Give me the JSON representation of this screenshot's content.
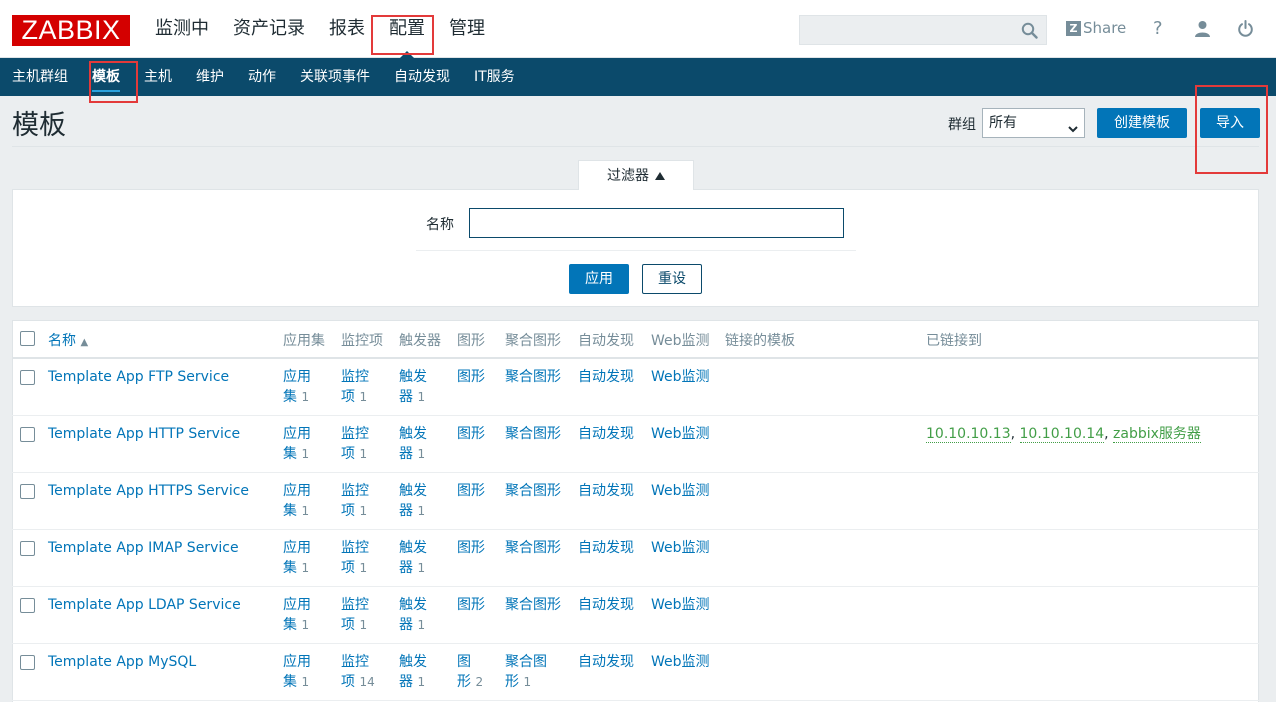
{
  "header": {
    "logo": "ZABBIX",
    "main_nav": [
      "监测中",
      "资产记录",
      "报表",
      "配置",
      "管理"
    ],
    "share": "Share",
    "help": "?",
    "search_value": ""
  },
  "sub_nav": [
    "主机群组",
    "模板",
    "主机",
    "维护",
    "动作",
    "关联项事件",
    "自动发现",
    "IT服务"
  ],
  "page": {
    "title": "模板",
    "group_label": "群组",
    "group_value": "所有",
    "create_button": "创建模板",
    "import_button": "导入"
  },
  "filter": {
    "tab_label": "过滤器",
    "name_label": "名称",
    "name_value": "",
    "apply_button": "应用",
    "reset_button": "重设"
  },
  "table": {
    "columns": {
      "name": "名称",
      "applications": "应用集",
      "items": "监控项",
      "triggers": "触发器",
      "graphs": "图形",
      "screens": "聚合图形",
      "discovery": "自动发现",
      "web": "Web监测",
      "linked_templates": "链接的模板",
      "linked_to": "已链接到"
    },
    "rows": [
      {
        "name": "Template App FTP Service",
        "app_a": "应用",
        "app_b": "集",
        "app_n": "1",
        "item_a": "监控",
        "item_b": "项",
        "item_n": "1",
        "trig_a": "触发",
        "trig_b": "器",
        "trig_n": "1",
        "graph_a": "图形",
        "graph_b": "",
        "graph_n": "",
        "screen_a": "聚合图形",
        "screen_b": "",
        "screen_n": "",
        "discovery": "自动发现",
        "web": "Web监测",
        "linked_to": []
      },
      {
        "name": "Template App HTTP Service",
        "app_a": "应用",
        "app_b": "集",
        "app_n": "1",
        "item_a": "监控",
        "item_b": "项",
        "item_n": "1",
        "trig_a": "触发",
        "trig_b": "器",
        "trig_n": "1",
        "graph_a": "图形",
        "graph_b": "",
        "graph_n": "",
        "screen_a": "聚合图形",
        "screen_b": "",
        "screen_n": "",
        "discovery": "自动发现",
        "web": "Web监测",
        "linked_to": [
          "10.10.10.13",
          "10.10.10.14",
          "zabbix服务器"
        ]
      },
      {
        "name": "Template App HTTPS Service",
        "app_a": "应用",
        "app_b": "集",
        "app_n": "1",
        "item_a": "监控",
        "item_b": "项",
        "item_n": "1",
        "trig_a": "触发",
        "trig_b": "器",
        "trig_n": "1",
        "graph_a": "图形",
        "graph_b": "",
        "graph_n": "",
        "screen_a": "聚合图形",
        "screen_b": "",
        "screen_n": "",
        "discovery": "自动发现",
        "web": "Web监测",
        "linked_to": []
      },
      {
        "name": "Template App IMAP Service",
        "app_a": "应用",
        "app_b": "集",
        "app_n": "1",
        "item_a": "监控",
        "item_b": "项",
        "item_n": "1",
        "trig_a": "触发",
        "trig_b": "器",
        "trig_n": "1",
        "graph_a": "图形",
        "graph_b": "",
        "graph_n": "",
        "screen_a": "聚合图形",
        "screen_b": "",
        "screen_n": "",
        "discovery": "自动发现",
        "web": "Web监测",
        "linked_to": []
      },
      {
        "name": "Template App LDAP Service",
        "app_a": "应用",
        "app_b": "集",
        "app_n": "1",
        "item_a": "监控",
        "item_b": "项",
        "item_n": "1",
        "trig_a": "触发",
        "trig_b": "器",
        "trig_n": "1",
        "graph_a": "图形",
        "graph_b": "",
        "graph_n": "",
        "screen_a": "聚合图形",
        "screen_b": "",
        "screen_n": "",
        "discovery": "自动发现",
        "web": "Web监测",
        "linked_to": []
      },
      {
        "name": "Template App MySQL",
        "app_a": "应用",
        "app_b": "集",
        "app_n": "1",
        "item_a": "监控",
        "item_b": "项",
        "item_n": "14",
        "trig_a": "触发",
        "trig_b": "器",
        "trig_n": "1",
        "graph_a": "图",
        "graph_b": "形",
        "graph_n": "2",
        "screen_a": "聚合图",
        "screen_b": "形",
        "screen_n": "1",
        "discovery": "自动发现",
        "web": "Web监测",
        "linked_to": []
      }
    ]
  },
  "colors": {
    "brand": "#d40000",
    "nav_bg": "#0b4a6b",
    "link": "#0275b8",
    "linked_host": "#429e47",
    "annotation": "#e33a3a"
  }
}
